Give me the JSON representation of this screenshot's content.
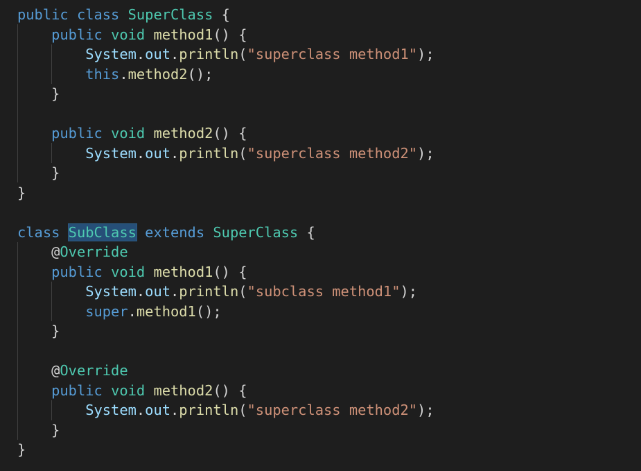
{
  "editor": {
    "theme": "dark",
    "background": "#1e1e1e",
    "colors": {
      "keyword": "#569cd6",
      "type": "#4ec9b0",
      "function": "#dcdcaa",
      "variable": "#9cdcfe",
      "string": "#ce9178",
      "highlight": "#264f78"
    },
    "code": {
      "sp_l1": "    ",
      "sp_l2": "        ",
      "super_class": {
        "l1": {
          "kw_public": "public",
          "kw_class": "class",
          "name": "SuperClass",
          "brace": "{"
        },
        "m1_decl": {
          "kw_public": "public",
          "kw_void": "void",
          "name": "method1",
          "parens": "()",
          "brace": "{"
        },
        "m1_print": {
          "sys": "System",
          "dot1": ".",
          "out": "out",
          "dot2": ".",
          "println": "println",
          "open": "(",
          "str": "\"superclass method1\"",
          "close": ");"
        },
        "m1_call": {
          "this": "this",
          "dot": ".",
          "method": "method2",
          "close": "();"
        },
        "m1_close": "}",
        "m2_decl": {
          "kw_public": "public",
          "kw_void": "void",
          "name": "method2",
          "parens": "()",
          "brace": "{"
        },
        "m2_print": {
          "sys": "System",
          "dot1": ".",
          "out": "out",
          "dot2": ".",
          "println": "println",
          "open": "(",
          "str": "\"superclass method2\"",
          "close": ");"
        },
        "m2_close": "}",
        "close": "}"
      },
      "sub_class": {
        "l1": {
          "kw_class": "class",
          "name": "SubClass",
          "kw_extends": "extends",
          "parent": "SuperClass",
          "brace": "{"
        },
        "m1_ann": {
          "at": "@",
          "name": "Override"
        },
        "m1_decl": {
          "kw_public": "public",
          "kw_void": "void",
          "name": "method1",
          "parens": "()",
          "brace": "{"
        },
        "m1_print": {
          "sys": "System",
          "dot1": ".",
          "out": "out",
          "dot2": ".",
          "println": "println",
          "open": "(",
          "str": "\"subclass method1\"",
          "close": ");"
        },
        "m1_call": {
          "super": "super",
          "dot": ".",
          "method": "method1",
          "close": "();"
        },
        "m1_close": "}",
        "m2_ann": {
          "at": "@",
          "name": "Override"
        },
        "m2_decl": {
          "kw_public": "public",
          "kw_void": "void",
          "name": "method2",
          "parens": "()",
          "brace": "{"
        },
        "m2_print": {
          "sys": "System",
          "dot1": ".",
          "out": "out",
          "dot2": ".",
          "println": "println",
          "open": "(",
          "str": "\"superclass method2\"",
          "close": ");"
        },
        "m2_close": "}",
        "close": "}"
      }
    }
  }
}
